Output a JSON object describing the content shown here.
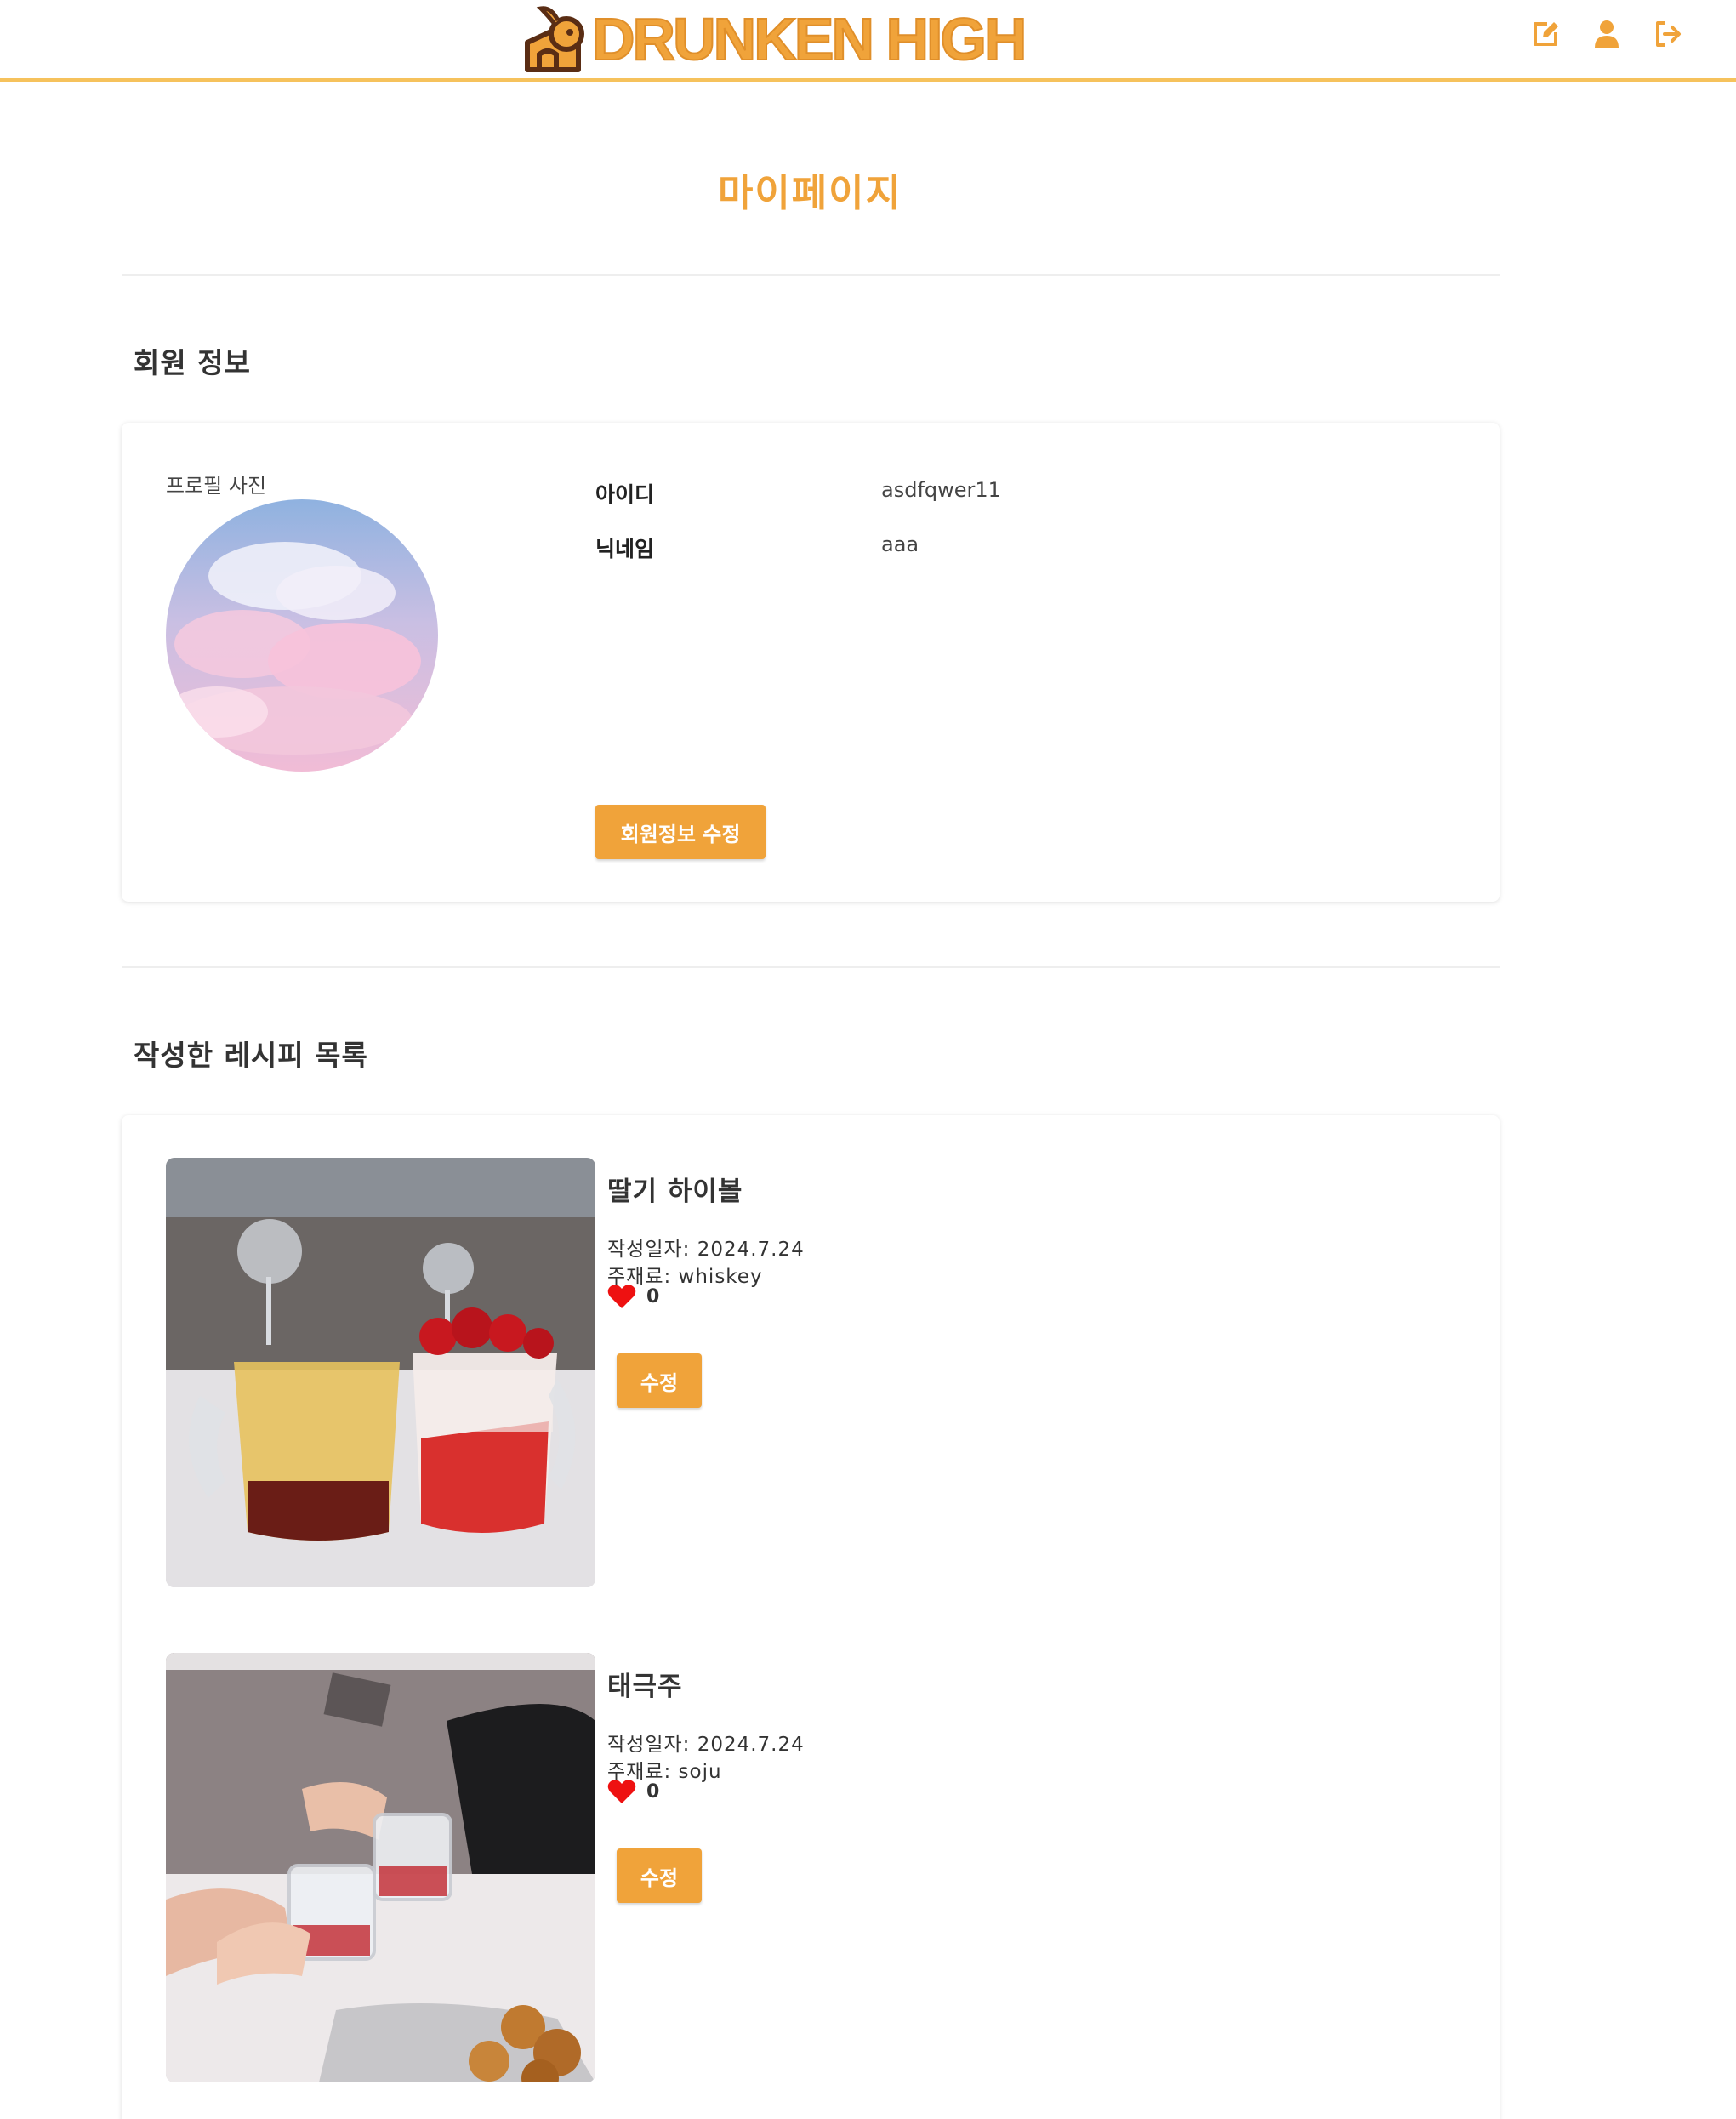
{
  "header": {
    "brand": "DRUNKEN HIGH",
    "icons": [
      "edit-icon",
      "user-icon",
      "logout-icon"
    ]
  },
  "page": {
    "title": "마이페이지"
  },
  "member": {
    "section_title": "회원 정보",
    "profile_label": "프로필 사진",
    "id_label": "아이디",
    "id_value": "asdfqwer11",
    "nickname_label": "닉네임",
    "nickname_value": "aaa",
    "edit_button": "회원정보 수정"
  },
  "recipes": {
    "section_title": "작성한 레시피 목록",
    "items": [
      {
        "title": "딸기 하이볼",
        "date": "작성일자: 2024.7.24",
        "ingredient": "주재료: whiskey",
        "likes": "0",
        "edit_button": "수정"
      },
      {
        "title": "태극주",
        "date": "작성일자: 2024.7.24",
        "ingredient": "주재료: soju",
        "likes": "0",
        "edit_button": "수정"
      }
    ]
  },
  "colors": {
    "accent": "#f0a33a",
    "header_border": "#f6c25c",
    "heart": "#ee1111",
    "logo_dark": "#5a2d14"
  }
}
